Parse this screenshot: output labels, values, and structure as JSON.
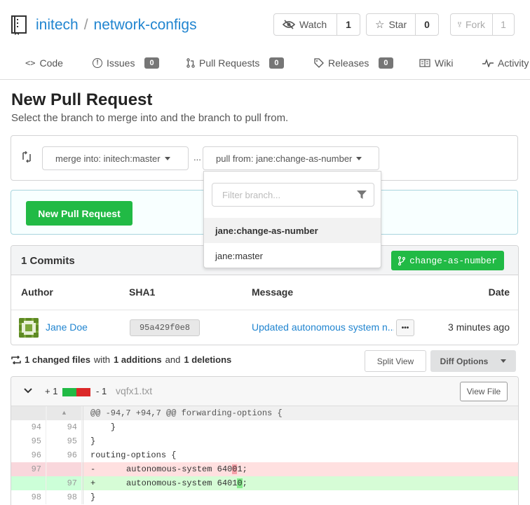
{
  "repo": {
    "owner": "initech",
    "separator": "/",
    "name": "network-configs"
  },
  "actions": {
    "watch": {
      "label": "Watch",
      "count": "1"
    },
    "star": {
      "label": "Star",
      "count": "0"
    },
    "fork": {
      "label": "Fork",
      "count": "1"
    }
  },
  "tabs": [
    {
      "label": "Code"
    },
    {
      "label": "Issues",
      "badge": "0"
    },
    {
      "label": "Pull Requests",
      "badge": "0"
    },
    {
      "label": "Releases",
      "badge": "0"
    },
    {
      "label": "Wiki"
    },
    {
      "label": "Activity"
    }
  ],
  "page": {
    "title": "New Pull Request",
    "subtitle": "Select the branch to merge into and the branch to pull from."
  },
  "branches": {
    "merge_into": "merge into: initech:master",
    "dots": "...",
    "pull_from": "pull from: jane:change-as-number"
  },
  "dropdown": {
    "filter_placeholder": "Filter branch...",
    "items": [
      "jane:change-as-number",
      "jane:master"
    ]
  },
  "new_pr_button": "New Pull Request",
  "commits": {
    "title": "1 Commits",
    "branch_label": "change-as-number",
    "columns": {
      "author": "Author",
      "sha": "SHA1",
      "message": "Message",
      "date": "Date"
    },
    "row": {
      "author": "Jane Doe",
      "sha": "95a429f0e8",
      "message": "Updated autonomous system n...",
      "ellipsis": "•••",
      "date": "3 minutes ago"
    }
  },
  "summary": {
    "files": "1 changed files",
    "with": "with",
    "additions": "1 additions",
    "and": "and",
    "deletions": "1 deletions"
  },
  "diff_controls": {
    "split_view": "Split View",
    "diff_options": "Diff Options"
  },
  "diff": {
    "add_count": "+ 1",
    "del_count": "- 1",
    "file": "vqfx1.txt",
    "view_file": "View File",
    "hunk": "@@ -94,7 +94,7 @@ forwarding-options {",
    "lines": [
      {
        "old": "94",
        "new": "94",
        "code": "    }"
      },
      {
        "old": "95",
        "new": "95",
        "code": "}"
      },
      {
        "old": "96",
        "new": "96",
        "code": "routing-options {"
      },
      {
        "old": "97",
        "new": "",
        "sign": "-",
        "pre": "    autonomous-system 640",
        "hl": "0",
        "post": "1;"
      },
      {
        "old": "",
        "new": "97",
        "sign": "+",
        "pre": "    autonomous-system 6401",
        "hl": "0",
        "post": ";"
      },
      {
        "old": "98",
        "new": "98",
        "code": "}"
      }
    ]
  },
  "colors": {
    "link": "#2185d0",
    "green": "#21ba45",
    "red": "#db2828"
  }
}
